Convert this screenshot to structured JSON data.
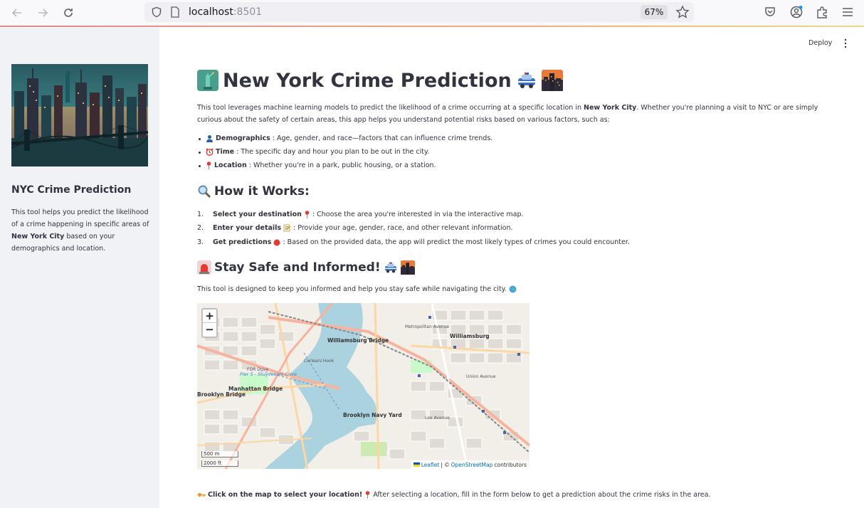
{
  "browser": {
    "url_host": "localhost",
    "url_port": ":8501",
    "zoom": "67%"
  },
  "sidebar": {
    "title": "NYC Crime Prediction",
    "description_pre": "This tool helps you predict the likelihood of a crime happening in specific areas of ",
    "description_bold": "New York City",
    "description_post": " based on your demographics and location."
  },
  "header": {
    "deploy_label": "Deploy"
  },
  "main": {
    "title": "New York Crime Prediction",
    "intro_pre": "This tool leverages machine learning models to predict the likelihood of a crime occurring at a specific location in ",
    "intro_bold": "New York City",
    "intro_post": ". Whether you're planning a visit to NYC or are simply curious about the safety of certain areas, this app helps you understand potential risks based on various factors, such as:",
    "bullets": [
      {
        "icon": "bust-icon",
        "bold": "Demographics",
        "text": ": Age, gender, and race—factors that can influence crime trends."
      },
      {
        "icon": "alarm-clock-icon",
        "bold": "Time",
        "text": ": The specific day and hour you plan to be out in the city."
      },
      {
        "icon": "pin-icon",
        "bold": "Location",
        "text": ": Whether you're in a park, public housing, or a station."
      }
    ],
    "how_title": "How it Works:",
    "steps": [
      {
        "n": "1.",
        "bold": "Select your destination",
        "icon": "pin-icon",
        "text": ": Choose the area you're interested in via the interactive map."
      },
      {
        "n": "2.",
        "bold": "Enter your details",
        "icon": "memo-icon",
        "text": ": Provide your age, gender, race, and other relevant information."
      },
      {
        "n": "3.",
        "bold": "Get predictions",
        "icon": "red-circle-icon",
        "text": ": Based on the provided data, the app will predict the most likely types of crimes you could encounter."
      }
    ],
    "safe_title": "Stay Safe and Informed!",
    "safe_text": "This tool is designed to keep you informed and help you stay safe while navigating the city.",
    "footer_bold": "Click on the map to select your location!",
    "footer_text": " After selecting a location, fill in the form below to get a prediction about the crime risks in the area."
  },
  "map": {
    "zoom_in": "+",
    "zoom_out": "−",
    "scale_m": "500 m",
    "scale_ft": "2000 ft",
    "attrib_leaflet": "Leaflet",
    "attrib_sep": " | © ",
    "attrib_osm": "OpenStreetMap",
    "attrib_post": " contributors",
    "labels": [
      {
        "text": "Williamsburg Bridge"
      },
      {
        "text": "Williamsburg"
      },
      {
        "text": "Manhattan Bridge"
      },
      {
        "text": "Brooklyn Bridge"
      },
      {
        "text": "Brooklyn Navy Yard"
      },
      {
        "text": "Corlears Hook"
      },
      {
        "text": "FDR Drive"
      },
      {
        "text": "Pier 5 - Stuyvesant Cove"
      },
      {
        "text": "Metropolitan Avenue"
      },
      {
        "text": "Union Avenue"
      },
      {
        "text": "Lee Avenue"
      }
    ]
  },
  "colors": {
    "sidebar_bg": "#f0f2f6",
    "text": "#31333f",
    "water": "#aad3df",
    "park": "#c8facc"
  }
}
